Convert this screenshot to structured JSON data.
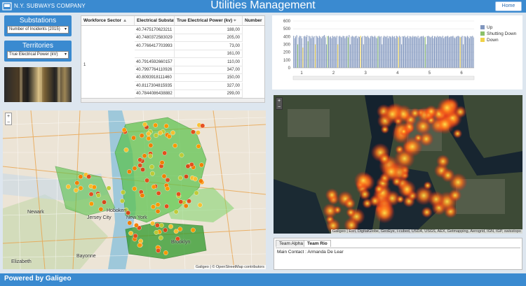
{
  "header": {
    "company": "N.Y. SUBWAYS COMPANY",
    "title": "Utilities Management",
    "home_label": "Home"
  },
  "substations": {
    "label": "Substations",
    "selected": "Number of Incidents (2015)"
  },
  "territories": {
    "label": "Territories",
    "selected": "True Electrical Power (kV)"
  },
  "table": {
    "columns": [
      "Workforce Sector",
      "Electrical Substation",
      "True Electrical Power (kv)",
      "Number"
    ],
    "sector": "1",
    "rows": [
      {
        "sub": "40.7475170623211",
        "power": "188,00"
      },
      {
        "sub": "40.7480372583029",
        "power": "205,00"
      },
      {
        "sub": "40.7766417703993",
        "power": "73,00"
      },
      {
        "sub": "",
        "power": "161,00"
      },
      {
        "sub": "40.7914592660157",
        "power": "110,00"
      },
      {
        "sub": "40.7997764110926",
        "power": "347,00"
      },
      {
        "sub": "40.8093918111460",
        "power": "150,00"
      },
      {
        "sub": "40.8117304815935",
        "power": "327,00"
      },
      {
        "sub": "40.7844086438882",
        "power": "299,00"
      }
    ]
  },
  "chart_data": {
    "type": "bar",
    "ylim": [
      0,
      600
    ],
    "yticks": [
      "600",
      "500",
      "400",
      "300",
      "200",
      "100",
      "0"
    ],
    "xticks": [
      "1",
      "2",
      "3",
      "4",
      "5",
      "6"
    ],
    "series": [
      {
        "name": "Up",
        "color": "#8096be"
      },
      {
        "name": "Shutting Down",
        "color": "#8cc06a"
      },
      {
        "name": "Down",
        "color": "#f0d248"
      }
    ],
    "values": [
      410,
      380,
      400,
      420,
      300,
      390,
      410,
      405,
      380,
      260,
      400,
      410,
      395,
      420,
      340,
      410,
      400,
      380,
      410,
      390,
      405,
      300,
      410,
      400,
      385,
      410,
      395,
      380,
      400,
      410,
      420,
      390,
      300,
      405,
      410,
      390,
      400,
      380,
      410,
      395,
      405,
      390,
      410,
      300,
      400,
      410,
      395,
      390,
      410,
      405,
      380,
      400,
      410,
      390,
      420,
      300,
      395,
      410,
      400,
      390,
      405,
      410,
      380,
      400,
      395,
      410,
      390,
      405,
      300,
      410,
      400,
      395,
      410,
      390,
      380,
      405,
      410,
      400,
      395,
      410,
      390,
      380,
      400,
      410,
      395,
      405,
      300,
      390,
      410,
      400,
      395,
      410,
      380,
      405,
      400,
      390,
      410,
      395,
      405,
      380,
      410,
      400,
      390,
      410,
      395,
      300,
      405,
      400,
      410,
      390,
      395,
      410,
      380,
      405,
      400,
      390,
      410,
      395,
      405,
      400,
      390,
      410,
      380,
      395,
      405,
      400,
      410,
      390,
      395,
      300,
      405,
      410,
      400,
      390,
      395,
      410,
      380,
      405,
      400,
      390,
      410,
      395,
      405,
      400,
      390,
      410,
      380,
      395,
      405,
      400,
      410,
      390,
      395,
      405,
      400,
      410,
      390,
      380,
      395,
      405,
      410,
      400,
      390,
      395,
      410,
      300,
      405,
      400,
      390,
      410,
      395,
      380,
      405,
      400,
      410,
      390
    ],
    "colors": "BBBBGBBBBYBBBBGBBBBBBYBBBBBBBBBBBGBBBBBBBBBYBBBBBBBBBGBBBBBBBBBBBYBBBBBBBBBBBBBBBBGBBBBBBBBBBBBBBBBBBBYBBBBBBBBBBBBBBBBBBBBBBBBBGBBBBBBBBBBBBBBBBBBBBBBBBBBBBBBBBBYBBBBBBBBBB"
  },
  "mapLeft": {
    "labels": [
      "Newark",
      "Elizabeth",
      "Hoboken",
      "New York",
      "Bayonne",
      "Brooklyn",
      "Jersey City"
    ],
    "attribution": "Galigeo | © OpenStreetMap contributors"
  },
  "mapRight": {
    "attribution": "Galigeo | Esri, DigitalGlobe, GeoEye, i-cubed, USDA, USGS, AEX, Getmapping, Aerogrid, IGN, IGP, swisstopo"
  },
  "tabs": {
    "items": [
      "Team Alpha",
      "Team Rio"
    ],
    "content": "Main Contact : Armanda De Lear"
  },
  "footer": {
    "text": "Powered by Galigeo"
  }
}
